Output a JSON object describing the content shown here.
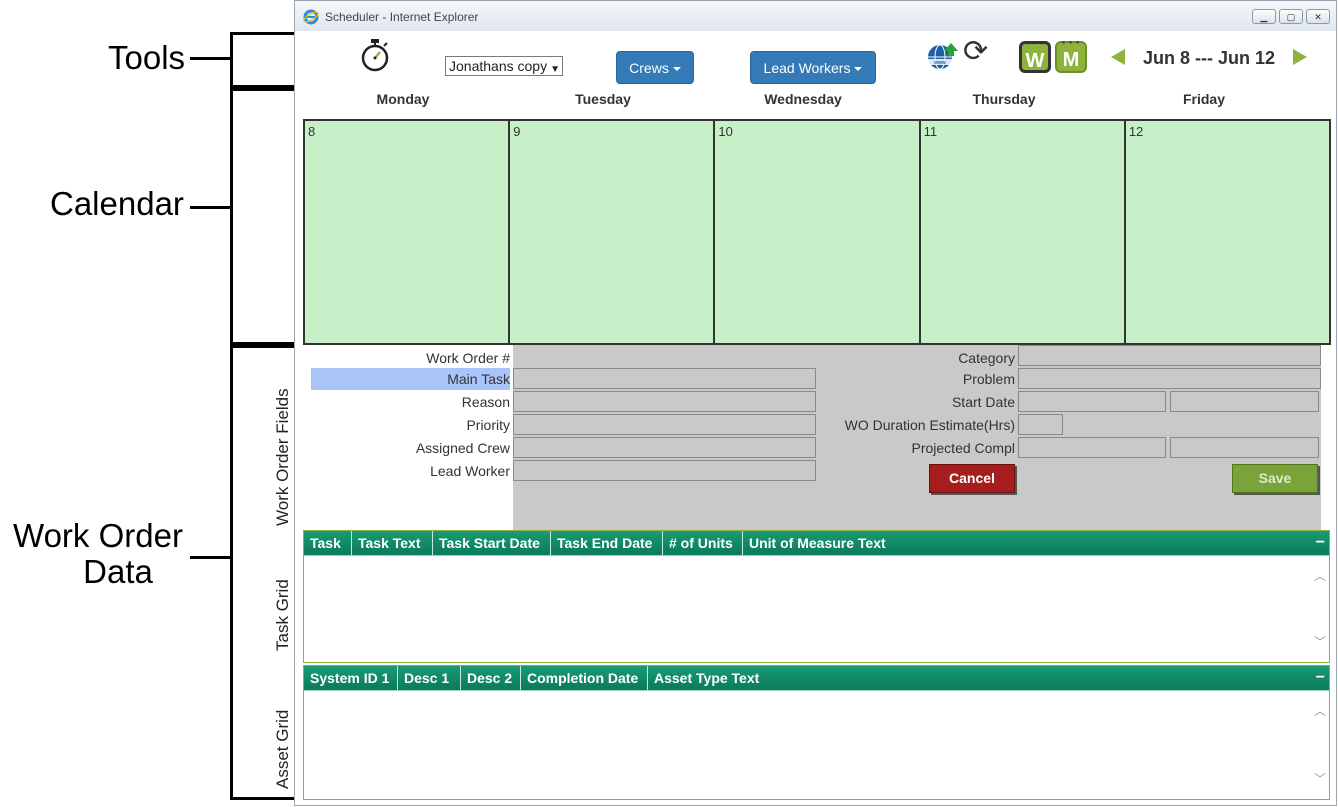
{
  "annotations": {
    "tools": "Tools",
    "calendar": "Calendar",
    "work_order_data_line1": "Work Order",
    "work_order_data_line2": "Data"
  },
  "window": {
    "title": "Scheduler - Internet Explorer",
    "minimize": "▁",
    "restore": "▢",
    "close": "✕"
  },
  "toolbar": {
    "select_value": "Jonathans copy",
    "crews_label": "Crews",
    "lead_workers_label": "Lead Workers",
    "week_button": "W",
    "month_button": "M",
    "date_range": "Jun 8 --- Jun 12",
    "icons": {
      "stopwatch": "stopwatch-icon",
      "globe": "globe-upload-icon",
      "refresh": "refresh-icon",
      "prev": "arrow-left-icon",
      "next": "arrow-right-icon"
    },
    "accent_color": "#8db33d",
    "button_color": "#337ab7"
  },
  "calendar": {
    "days": [
      {
        "name": "Monday",
        "num": "8"
      },
      {
        "name": "Tuesday",
        "num": "9"
      },
      {
        "name": "Wednesday",
        "num": "10"
      },
      {
        "name": "Thursday",
        "num": "11"
      },
      {
        "name": "Friday",
        "num": "12"
      }
    ],
    "cell_color": "#c8f0c8"
  },
  "work_order_fields": {
    "section_label": "Work Order Fields",
    "left": [
      "Work Order #",
      "Main Task",
      "Reason",
      "Priority",
      "Assigned Crew",
      "Lead Worker"
    ],
    "right": [
      "Category",
      "Problem",
      "Start Date",
      "WO Duration Estimate(Hrs)",
      "Projected Compl"
    ],
    "cancel_label": "Cancel",
    "save_label": "Save"
  },
  "task_grid": {
    "section_label": "Task Grid",
    "columns": [
      "Task",
      "Task Text",
      "Task Start Date",
      "Task End Date",
      "# of Units",
      "Unit of Measure Text"
    ],
    "collapse": "−",
    "header_color": "#0a7a5a"
  },
  "asset_grid": {
    "section_label": "Asset Grid",
    "columns": [
      "System ID 1",
      "Desc 1",
      "Desc 2",
      "Completion Date",
      "Asset Type Text"
    ],
    "collapse": "−"
  }
}
